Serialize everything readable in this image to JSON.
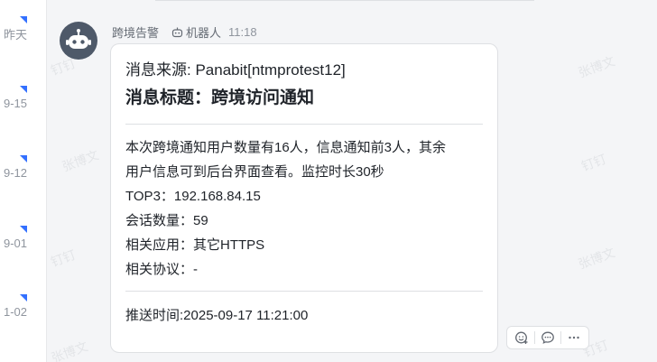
{
  "sidebar": {
    "dates": [
      "昨天",
      "9-15",
      "9-12",
      "9-01",
      "1-02"
    ],
    "flag_color": "#3370ff"
  },
  "watermarks": {
    "text_a": "钉钉",
    "text_b": "张博文"
  },
  "message": {
    "sender": "跨境告警",
    "bot_label": "机器人",
    "time": "11:18",
    "avatar_icon": "robot-icon"
  },
  "card": {
    "source": "消息来源: Panabit[ntmprotest12]",
    "title": "消息标题：跨境访问通知",
    "body_lines": [
      "本次跨境通知用户数量有16人，信息通知前3人，其余",
      "用户信息可到后台界面查看。监控时长30秒",
      "TOP3：192.168.84.15",
      "会话数量：59",
      "相关应用：其它HTTPS",
      "相关协议：-"
    ],
    "footer": "推送时间:2025-09-17 11:21:00"
  },
  "actions": {
    "icons": [
      "add-reaction-icon",
      "comment-icon",
      "more-icon"
    ]
  }
}
